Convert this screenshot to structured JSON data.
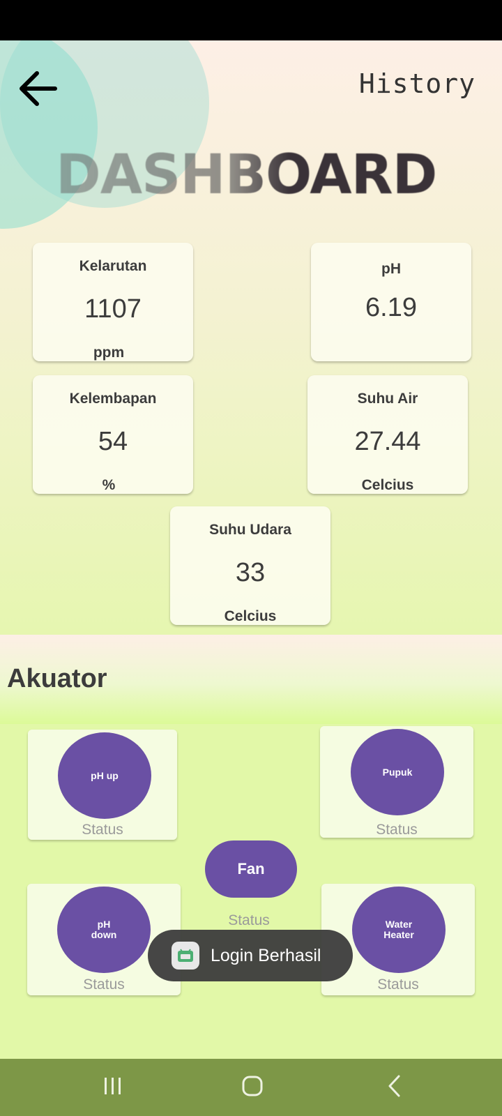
{
  "header": {
    "history_label": "History",
    "title": "DASHBOARD"
  },
  "sensors": [
    {
      "label": "Kelarutan",
      "value": "1107",
      "unit": "ppm"
    },
    {
      "label": "pH",
      "value": "6.19",
      "unit": ""
    },
    {
      "label": "Kelembapan",
      "value": "54",
      "unit": "%"
    },
    {
      "label": "Suhu Air",
      "value": "27.44",
      "unit": "Celcius"
    },
    {
      "label": "Suhu Udara",
      "value": "33",
      "unit": "Celcius"
    }
  ],
  "akuator": {
    "title": "Akuator",
    "items": [
      {
        "label": "pH up",
        "status": "Status"
      },
      {
        "label": "Pupuk",
        "status": "Status"
      },
      {
        "label": "Fan",
        "status": "Status"
      },
      {
        "label": "pH\ndown",
        "status": "Status"
      },
      {
        "label": "Water\nHeater",
        "status": "Status"
      }
    ]
  },
  "toast": {
    "message": "Login Berhasil"
  },
  "colors": {
    "accent": "#6a50a4",
    "nav_bar": "#7d9747",
    "card": "#fcfcee"
  },
  "icons": {
    "back": "arrow-left-icon",
    "toast": "android-app-icon",
    "nav_recents": "recents-icon",
    "nav_home": "home-icon",
    "nav_back": "chevron-left-icon"
  }
}
